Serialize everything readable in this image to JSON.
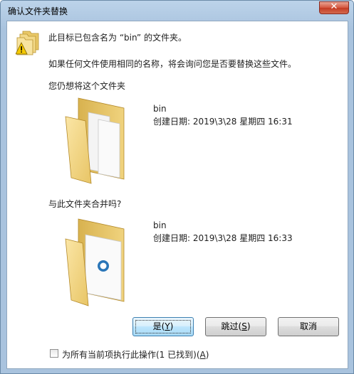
{
  "window": {
    "title": "确认文件夹替换"
  },
  "message": {
    "line1": "此目标已包含名为 “bin” 的文件夹。",
    "line2": "如果任何文件使用相同的名称，将会询问您是否要替换这些文件。",
    "line3": "您仍想将这个文件夹"
  },
  "source_folder": {
    "name": "bin",
    "created": "创建日期: 2019\\3\\28 星期四 16:31"
  },
  "merge_prompt": "与此文件夹合并吗?",
  "target_folder": {
    "name": "bin",
    "created": "创建日期: 2019\\3\\28 星期四 16:33"
  },
  "buttons": {
    "yes": {
      "label": "是(",
      "mnemonic": "Y",
      "suffix": ")"
    },
    "skip": {
      "label": "跳过(",
      "mnemonic": "S",
      "suffix": ")"
    },
    "cancel": {
      "label": "取消"
    }
  },
  "apply_all": {
    "label": "为所有当前项执行此操作(1 已找到)(",
    "mnemonic": "A",
    "suffix": ")",
    "checked": false
  },
  "icons": {
    "close": "close-icon",
    "warning": "warning-folder-icon",
    "source": "documents-folder-icon",
    "target": "app-folder-icon"
  }
}
